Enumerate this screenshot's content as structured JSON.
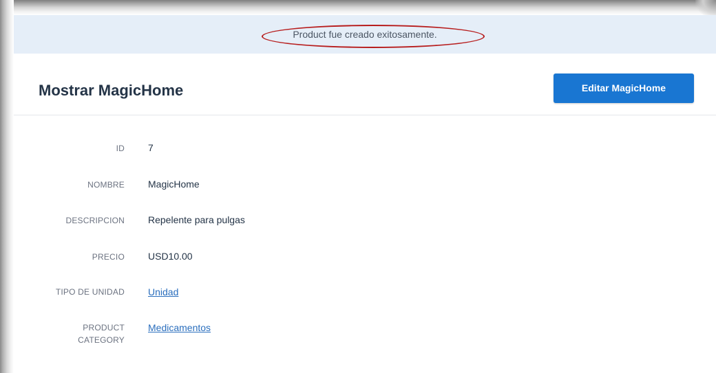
{
  "flash": {
    "message": "Product fue creado exitosamente."
  },
  "header": {
    "title": "Mostrar MagicHome",
    "edit_button_label": "Editar MagicHome"
  },
  "details": {
    "id": {
      "label": "ID",
      "value": "7"
    },
    "nombre": {
      "label": "NOMBRE",
      "value": "MagicHome"
    },
    "descripcion": {
      "label": "DESCRIPCION",
      "value": "Repelente para pulgas"
    },
    "precio": {
      "label": "PRECIO",
      "value": "USD10.00"
    },
    "tipo_de_unidad": {
      "label": "TIPO DE UNIDAD",
      "value": "Unidad"
    },
    "product_category": {
      "label_line1": "PRODUCT",
      "label_line2": "CATEGORY",
      "value": "Medicamentos"
    }
  },
  "colors": {
    "flash_background": "#e5eef8",
    "primary_button": "#1976d2",
    "link": "#2a6ebd",
    "highlight_ellipse": "#b71c1c"
  }
}
